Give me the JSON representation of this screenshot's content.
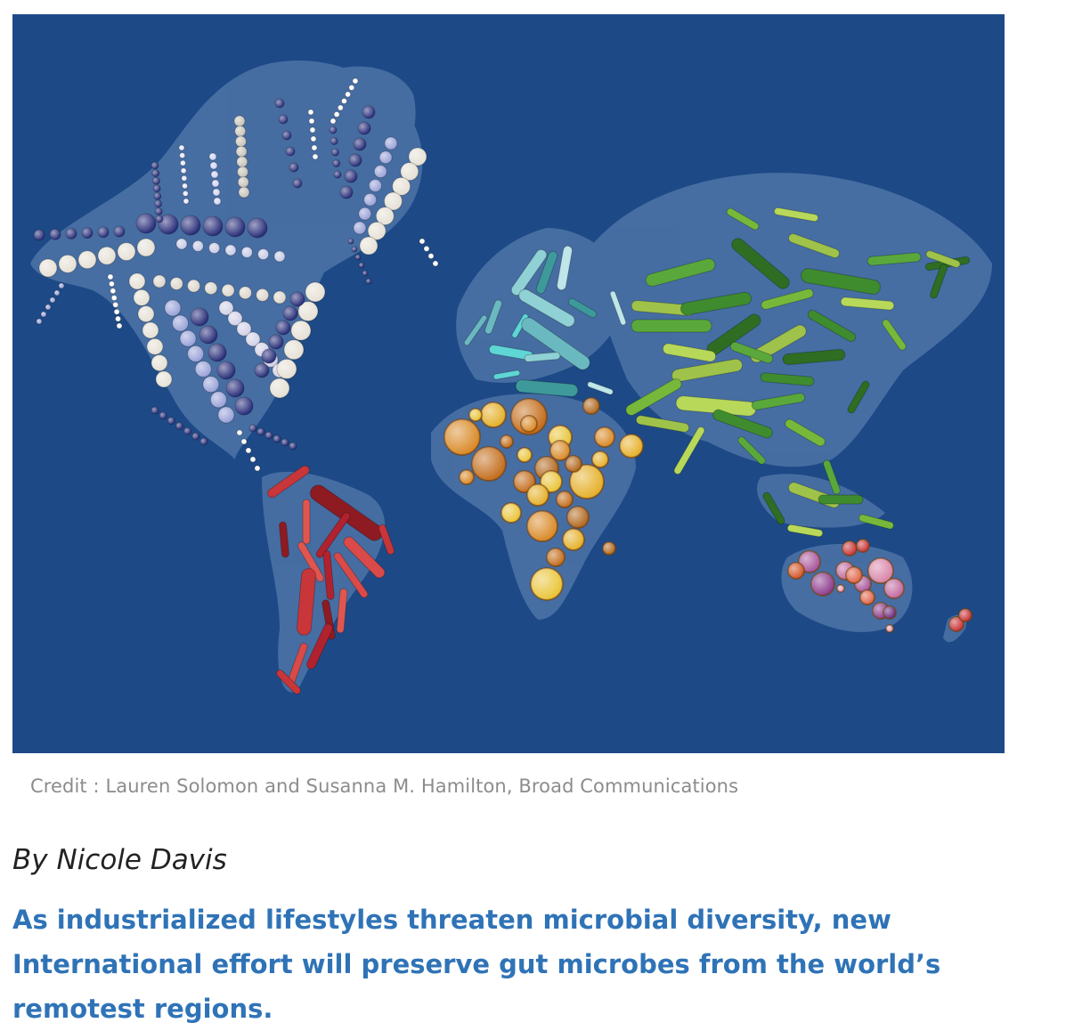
{
  "figure": {
    "alt": "World map illustrated with gut microbes shaped like bacteria across continents"
  },
  "caption": "Credit : Lauren Solomon and Susanna M. Hamilton, Broad Communications",
  "byline": "By Nicole Davis",
  "subhead": "As industrialized lifestyles threaten microbial diversity, new International effort will preserve gut microbes from the world’s remotest regions.",
  "colors": {
    "ocean": "#1d4a86",
    "land": "#4e74a8",
    "north_america": "#2a2f7a",
    "north_america_light": "#e6e1d6",
    "south_america": "#c8363a",
    "europe": "#8fd1d4",
    "asia": "#5aa83c",
    "africa": "#d98b2a",
    "australia": "#a8579c",
    "subhead": "#2f73b7"
  }
}
